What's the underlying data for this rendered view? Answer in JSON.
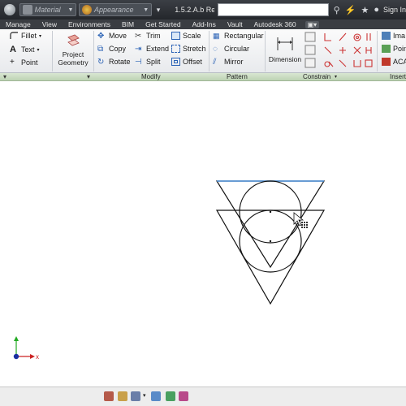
{
  "titlebar": {
    "material": "Material",
    "appearance": "Appearance",
    "document_title": "1.5.2.A.b Re...",
    "sign_in": "Sign In"
  },
  "tabs": [
    "Manage",
    "View",
    "Environments",
    "BIM",
    "Get Started",
    "Add-Ins",
    "Vault",
    "Autodesk 360"
  ],
  "ribbon": {
    "draw_group": [
      {
        "label": "Fillet"
      },
      {
        "label": "Text"
      },
      {
        "label": "Point"
      }
    ],
    "project_geometry": [
      "Project",
      "Geometry"
    ],
    "modify": [
      {
        "label": "Move"
      },
      {
        "label": "Copy"
      },
      {
        "label": "Rotate"
      },
      {
        "label": "Trim"
      },
      {
        "label": "Extend"
      },
      {
        "label": "Split"
      },
      {
        "label": "Scale"
      },
      {
        "label": "Stretch"
      },
      {
        "label": "Offset"
      }
    ],
    "pattern": [
      {
        "label": "Rectangular"
      },
      {
        "label": "Circular"
      },
      {
        "label": "Mirror"
      }
    ],
    "dimension": "Dimension",
    "insert": [
      {
        "label": "Ima"
      },
      {
        "label": "Poin"
      },
      {
        "label": "ACA"
      }
    ]
  },
  "panels": {
    "modify": "Modify",
    "pattern": "Pattern",
    "constrain": "Constrain",
    "insert": "Insert"
  },
  "axis": {
    "x_label": "x"
  },
  "colors": {
    "title_bg": "#2b2e33",
    "panel_label_bg": "#c8dcc0",
    "selected_line": "#4a90d9",
    "axis_x": "#cc2222",
    "axis_y": "#22aa22",
    "origin": "#1a2fa0"
  }
}
